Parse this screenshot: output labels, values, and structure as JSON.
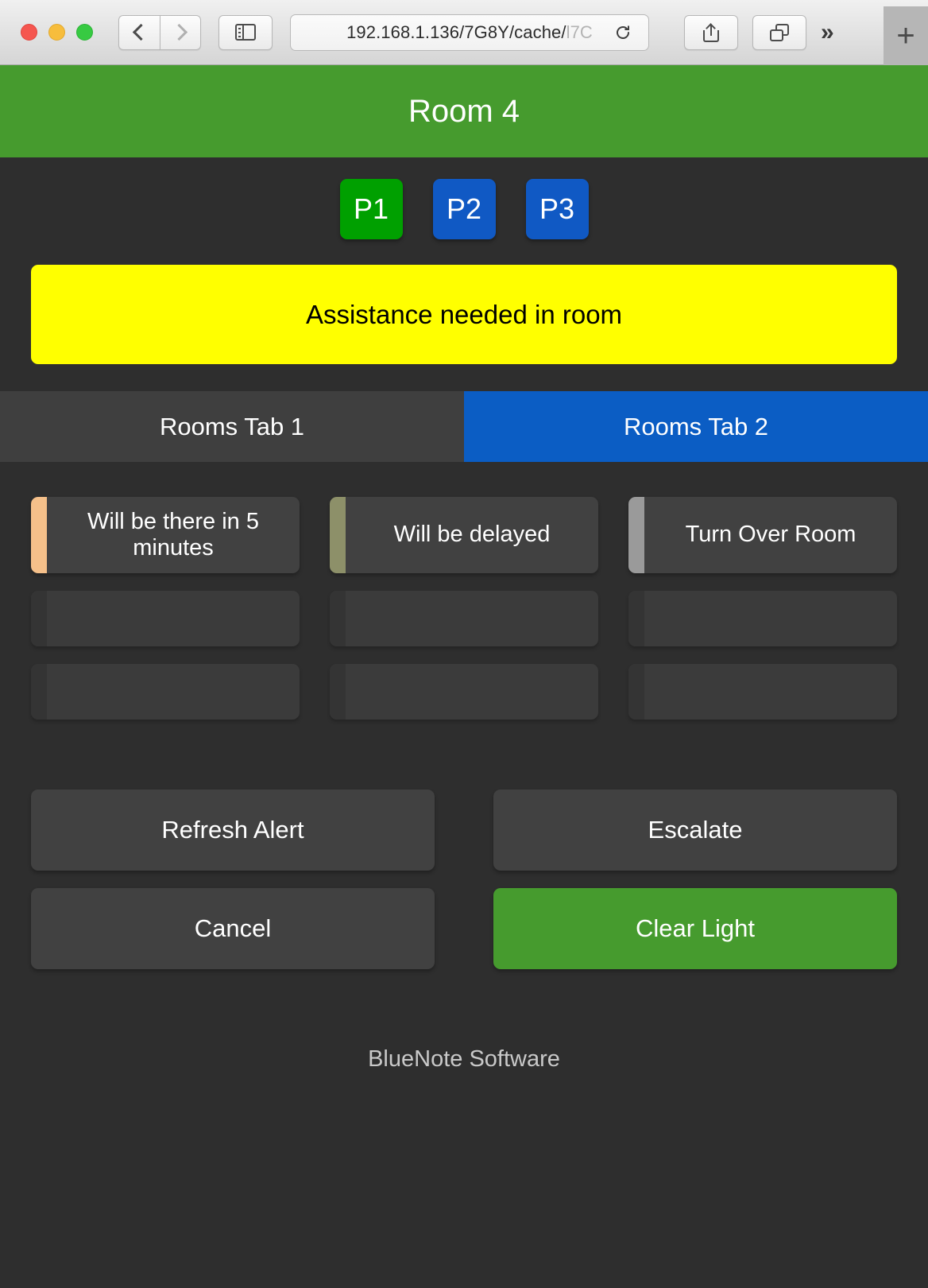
{
  "browser": {
    "url_visible": "192.168.1.136/7G8Y/cache/",
    "url_faded": "l7C",
    "back_icon": "chevron-left-icon",
    "forward_icon": "chevron-right-icon",
    "sidebar_icon": "sidebar-icon",
    "reload_icon": "reload-icon",
    "share_icon": "share-icon",
    "tabs_icon": "tab-overview-icon",
    "overflow_label": "»",
    "new_tab_label": "+"
  },
  "app": {
    "header": {
      "title": "Room 4",
      "color": "#469b2e"
    },
    "priority_buttons": [
      {
        "label": "P1",
        "color": "#00a000",
        "active": true
      },
      {
        "label": "P2",
        "color": "#1059c4",
        "active": false
      },
      {
        "label": "P3",
        "color": "#1059c4",
        "active": false
      }
    ],
    "alert": {
      "message": "Assistance needed in room",
      "bg": "#ffff00",
      "fg": "#000000"
    },
    "tabs": [
      {
        "label": "Rooms Tab 1",
        "active": false,
        "color": "#3f3f3f"
      },
      {
        "label": "Rooms Tab 2",
        "active": true,
        "color": "#0b5dc4"
      }
    ],
    "response_grid": {
      "rows": [
        [
          {
            "label": "Will be there in 5 minutes",
            "bar_color": "#f5c08a",
            "empty": false
          },
          {
            "label": "Will be delayed",
            "bar_color": "#8d9069",
            "empty": false
          },
          {
            "label": "Turn Over Room",
            "bar_color": "#9a9a9a",
            "empty": false
          }
        ],
        [
          {
            "label": "",
            "bar_color": "#343434",
            "empty": true
          },
          {
            "label": "",
            "bar_color": "#343434",
            "empty": true
          },
          {
            "label": "",
            "bar_color": "#343434",
            "empty": true
          }
        ],
        [
          {
            "label": "",
            "bar_color": "#343434",
            "empty": true
          },
          {
            "label": "",
            "bar_color": "#343434",
            "empty": true
          },
          {
            "label": "",
            "bar_color": "#343434",
            "empty": true
          }
        ]
      ]
    },
    "actions": [
      [
        {
          "label": "Refresh Alert",
          "style": "default"
        },
        {
          "label": "Escalate",
          "style": "default"
        }
      ],
      [
        {
          "label": "Cancel",
          "style": "default"
        },
        {
          "label": "Clear Light",
          "style": "green"
        }
      ]
    ],
    "footer": {
      "brand": "BlueNote Software"
    }
  }
}
